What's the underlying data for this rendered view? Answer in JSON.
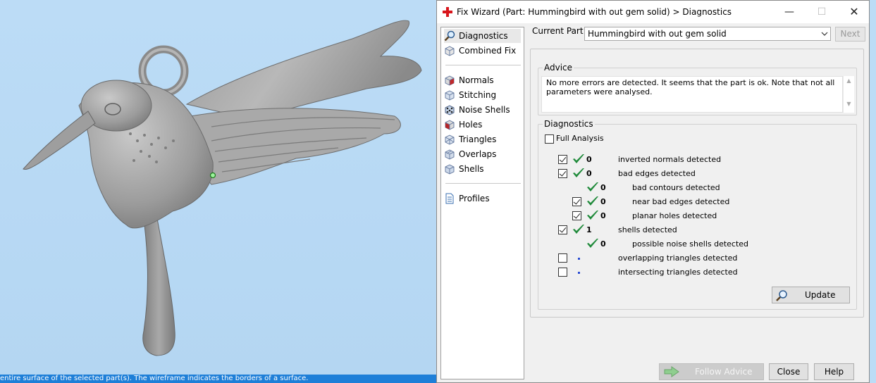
{
  "window": {
    "title": "Fix Wizard (Part: Hummingbird with out gem solid) > Diagnostics",
    "minimize": "—",
    "maximize": "☐",
    "close": "✕"
  },
  "status_bar": {
    "text": "entire surface of the selected part(s). The wireframe indicates the borders of a surface."
  },
  "nav": {
    "items": [
      {
        "label": "Diagnostics",
        "icon": "magnifier-icon"
      },
      {
        "label": "Combined Fix",
        "icon": "cube-icon"
      },
      {
        "label": "Normals",
        "icon": "normals-cube-icon"
      },
      {
        "label": "Stitching",
        "icon": "stitching-cube-icon"
      },
      {
        "label": "Noise Shells",
        "icon": "noise-shells-icon"
      },
      {
        "label": "Holes",
        "icon": "holes-cube-icon"
      },
      {
        "label": "Triangles",
        "icon": "triangles-cube-icon"
      },
      {
        "label": "Overlaps",
        "icon": "overlaps-cube-icon"
      },
      {
        "label": "Shells",
        "icon": "shells-cube-icon"
      },
      {
        "label": "Profiles",
        "icon": "document-icon"
      }
    ]
  },
  "header": {
    "current_part_label": "Current Part:",
    "current_part_value": "Hummingbird with out gem solid",
    "next_label": "Next"
  },
  "advice": {
    "group_label": "Advice",
    "text": "No more errors are detected. It seems that the part is ok. Note that not all parameters were analysed."
  },
  "diagnostics": {
    "group_label": "Diagnostics",
    "full_analysis_label": "Full Analysis",
    "full_analysis_checked": false,
    "rows": [
      {
        "checkbox": true,
        "checked": true,
        "status": "ok",
        "count": "0",
        "label": "inverted normals detected",
        "indent": 0
      },
      {
        "checkbox": true,
        "checked": true,
        "status": "ok",
        "count": "0",
        "label": "bad edges detected",
        "indent": 0
      },
      {
        "checkbox": false,
        "checked": false,
        "status": "ok",
        "count": "0",
        "label": "bad contours detected",
        "indent": 1
      },
      {
        "checkbox": true,
        "checked": true,
        "status": "ok",
        "count": "0",
        "label": "near bad edges detected",
        "indent": 1
      },
      {
        "checkbox": true,
        "checked": true,
        "status": "ok",
        "count": "0",
        "label": "planar holes detected",
        "indent": 1
      },
      {
        "checkbox": true,
        "checked": true,
        "status": "ok",
        "count": "1",
        "label": "shells detected",
        "indent": 0
      },
      {
        "checkbox": false,
        "checked": false,
        "status": "ok",
        "count": "0",
        "label": "possible noise shells detected",
        "indent": 1
      },
      {
        "checkbox": true,
        "checked": false,
        "status": "dot",
        "count": "",
        "label": "overlapping triangles detected",
        "indent": 0
      },
      {
        "checkbox": true,
        "checked": false,
        "status": "dot",
        "count": "",
        "label": "intersecting triangles detected",
        "indent": 0
      }
    ],
    "update_label": "Update"
  },
  "footer": {
    "follow_advice_label": "Follow Advice",
    "close_label": "Close",
    "help_label": "Help"
  },
  "colors": {
    "viewport_bg": "#b9daf4",
    "status_bar": "#1e7fd8",
    "ok_green": "#1f8a3a",
    "model_gray": "#8d8d8d"
  }
}
